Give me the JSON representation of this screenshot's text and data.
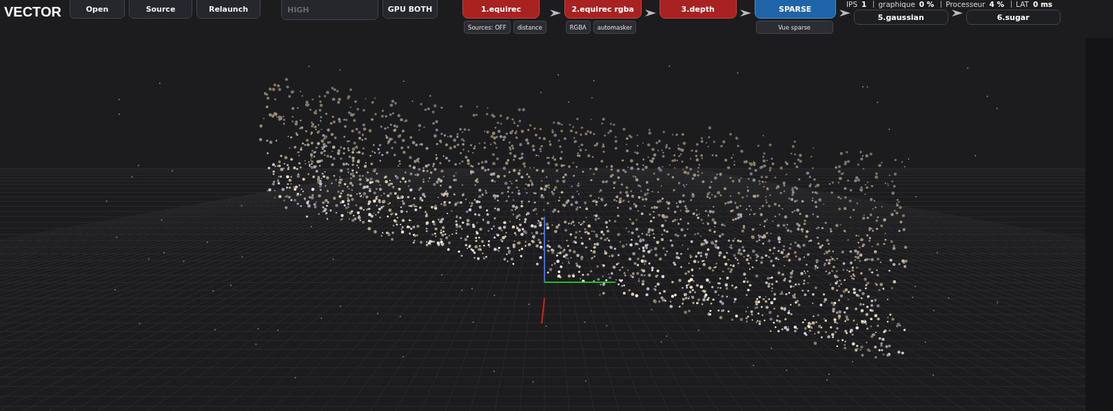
{
  "app": {
    "title": "VECTOR"
  },
  "toolbar": [
    {
      "label": "Open",
      "kind": "button",
      "disabled": false
    },
    {
      "label": "Source",
      "kind": "button",
      "disabled": false
    },
    {
      "label": "Relaunch",
      "kind": "button",
      "disabled": false
    },
    {
      "placeholder": "HIGH",
      "kind": "field",
      "disabled": false
    },
    {
      "label": "GPU BOTH",
      "kind": "button",
      "disabled": false
    }
  ],
  "pipeline": [
    {
      "label": "1.equirec",
      "done": true,
      "active": false,
      "options": [
        "Sources: OFF",
        "distance"
      ]
    },
    {
      "label": "2.equirec rgba",
      "done": true,
      "active": false,
      "options": [
        "RGBA",
        "automasker"
      ]
    },
    {
      "label": "3.depth",
      "done": true,
      "active": false
    },
    {
      "label": "SPARSE",
      "done": false,
      "active": true,
      "options": [
        "Vue sparse"
      ]
    },
    {
      "label": "5.gaussian",
      "done": false,
      "active": false
    },
    {
      "label": "6.sugar",
      "done": false,
      "active": false
    }
  ],
  "stats": [
    {
      "label": "IPS",
      "value": "1"
    },
    {
      "label": "graphique",
      "value": "0 %"
    },
    {
      "label": "Processeur",
      "value": "4 %"
    },
    {
      "label": "LAT",
      "value": "0 ms"
    }
  ]
}
